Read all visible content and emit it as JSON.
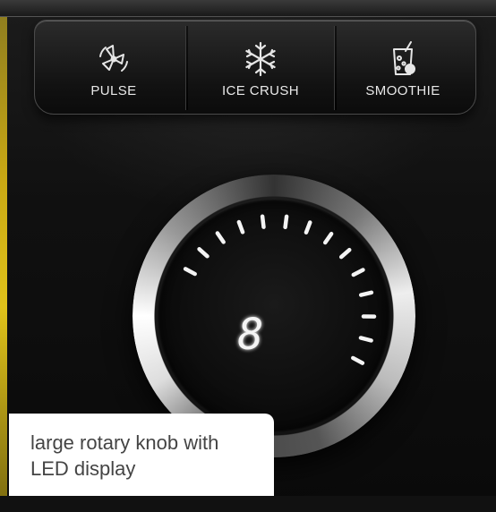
{
  "buttons": [
    {
      "label": "PULSE",
      "icon": "pulse-icon"
    },
    {
      "label": "ICE CRUSH",
      "icon": "snowflake-icon"
    },
    {
      "label": "SMOOTHIE",
      "icon": "smoothie-cup-icon"
    }
  ],
  "display": {
    "digit": "8",
    "level_segments_lit": 14
  },
  "caption": {
    "line1": "large rotary knob with",
    "line2": "LED display"
  },
  "colors": {
    "panel": "#1a1a1a",
    "led": "#f4f4f4",
    "caption_bg": "#ffffff",
    "caption_text": "#444444"
  }
}
